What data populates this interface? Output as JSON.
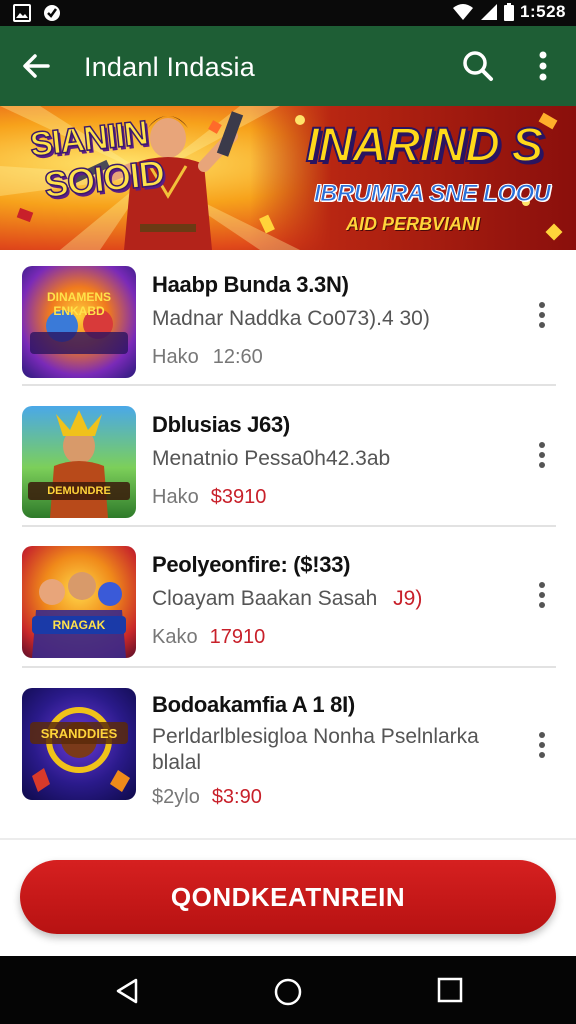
{
  "status_bar": {
    "time": "1:528"
  },
  "app_bar": {
    "title": "Indanl Indasia"
  },
  "banner": {
    "left_line1": "SIANIIN",
    "left_line2": "SOIOID",
    "title": "INARIND S",
    "subtitle": "IBRUMRA SNE LOOU",
    "tagline": "AID PERBVIANI"
  },
  "thumbnails": [
    {
      "caption": "DINAMENS ENKABD"
    },
    {
      "caption": "DEMUNDRE"
    },
    {
      "caption": "RNAGAK"
    },
    {
      "caption": "SRANDDIES"
    }
  ],
  "items": [
    {
      "title": "Haabp Bunda 3.3N)",
      "subtitle": "Madnar Naddka Co073).4 30)",
      "meta_label": "Hako",
      "price": "12:60"
    },
    {
      "title": "Dblusias J63)",
      "subtitle": "Menatnio Pessa0h42.3ab",
      "meta_label": "Hako",
      "price": "$3910"
    },
    {
      "title": "Peolyeonfire: ($!33)",
      "subtitle": "Cloayam Baakan Sasah",
      "subtitle_accent": "J9)",
      "meta_label": "Kako",
      "price": "17910"
    },
    {
      "title": "Bodoakamfia A 1 8I)",
      "subtitle": "Perldarlblesigloa Nonha Pselnlarka blalal",
      "meta_label": "$2ylo",
      "price": "$3:90"
    }
  ],
  "cta": {
    "label": "QONDKEATNREIN"
  },
  "colors": {
    "app_bar": "#1e5e35",
    "accent_red": "#c8202a",
    "cta": "#c41818"
  }
}
